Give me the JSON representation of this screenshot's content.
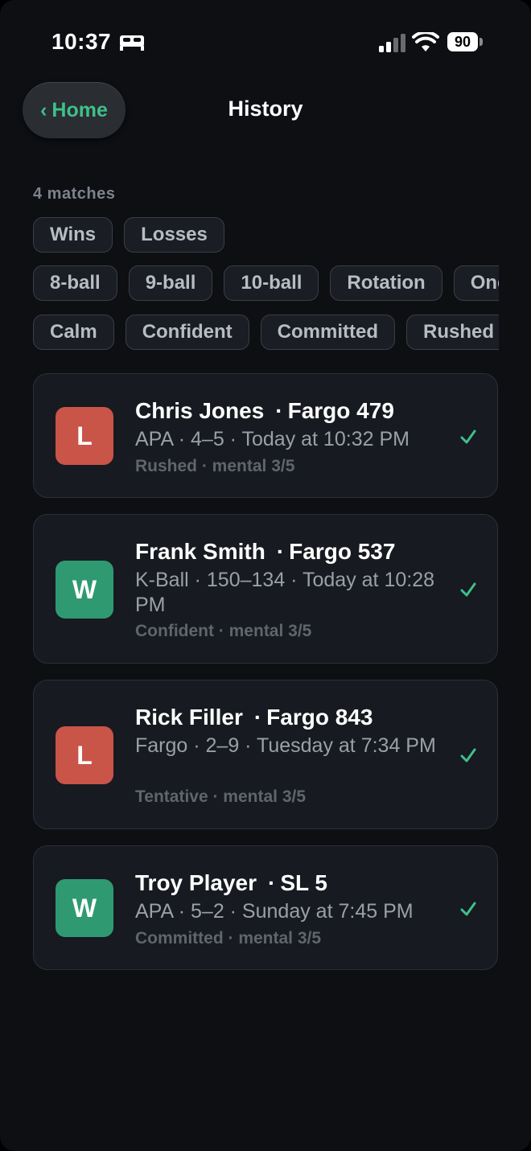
{
  "status_bar": {
    "time": "10:37",
    "battery": "90"
  },
  "nav": {
    "back_label": "Home",
    "title": "History"
  },
  "summary": {
    "count": "4 matches"
  },
  "filters": {
    "result": [
      "Wins",
      "Losses"
    ],
    "game": [
      "8-ball",
      "9-ball",
      "10-ball",
      "Rotation",
      "One-pocket"
    ],
    "mood": [
      "Calm",
      "Confident",
      "Committed",
      "Rushed"
    ]
  },
  "matches": [
    {
      "result": "L",
      "opponent": "Chris Jones",
      "rating": "Fargo 479",
      "detail": "APA · 4–5 · Today at 10:32 PM",
      "meta": "Rushed · mental 3/5"
    },
    {
      "result": "W",
      "opponent": "Frank Smith",
      "rating": "Fargo 537",
      "detail": "K-Ball · 150–134 · Today at 10:28 PM",
      "meta": "Confident · mental 3/5"
    },
    {
      "result": "L",
      "opponent": "Rick Filler",
      "rating": "Fargo 843",
      "detail": "Fargo · 2–9 · Tuesday at 7:34 PM",
      "meta": "Tentative · mental 3/5"
    },
    {
      "result": "W",
      "opponent": "Troy Player",
      "rating": "SL 5",
      "detail": "APA · 5–2 · Sunday at 7:45 PM",
      "meta": "Committed · mental 3/5"
    }
  ],
  "colors": {
    "accent": "#3fbf8a",
    "loss": "#c95448",
    "win": "#2f9a72",
    "background": "#0d0f13"
  }
}
